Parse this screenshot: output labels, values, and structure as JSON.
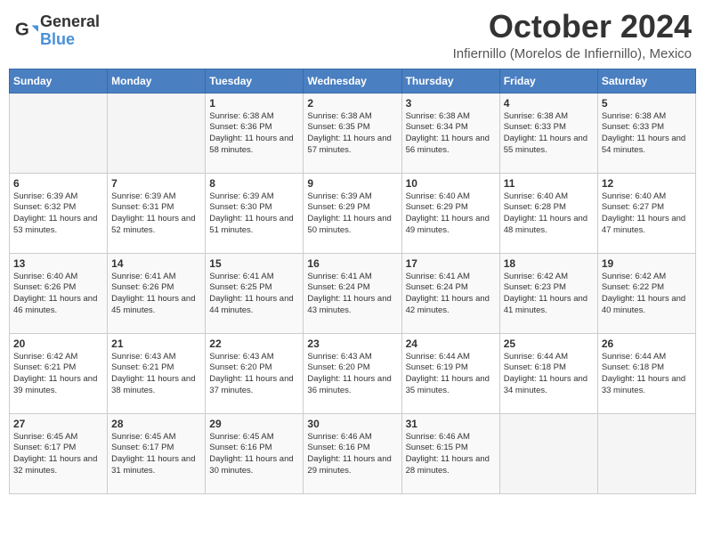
{
  "header": {
    "logo_line1": "General",
    "logo_line2": "Blue",
    "month": "October 2024",
    "subtitle": "Infiernillo (Morelos de Infiernillo), Mexico"
  },
  "weekdays": [
    "Sunday",
    "Monday",
    "Tuesday",
    "Wednesday",
    "Thursday",
    "Friday",
    "Saturday"
  ],
  "weeks": [
    [
      {
        "day": "",
        "info": ""
      },
      {
        "day": "",
        "info": ""
      },
      {
        "day": "1",
        "info": "Sunrise: 6:38 AM\nSunset: 6:36 PM\nDaylight: 11 hours and 58 minutes."
      },
      {
        "day": "2",
        "info": "Sunrise: 6:38 AM\nSunset: 6:35 PM\nDaylight: 11 hours and 57 minutes."
      },
      {
        "day": "3",
        "info": "Sunrise: 6:38 AM\nSunset: 6:34 PM\nDaylight: 11 hours and 56 minutes."
      },
      {
        "day": "4",
        "info": "Sunrise: 6:38 AM\nSunset: 6:33 PM\nDaylight: 11 hours and 55 minutes."
      },
      {
        "day": "5",
        "info": "Sunrise: 6:38 AM\nSunset: 6:33 PM\nDaylight: 11 hours and 54 minutes."
      }
    ],
    [
      {
        "day": "6",
        "info": "Sunrise: 6:39 AM\nSunset: 6:32 PM\nDaylight: 11 hours and 53 minutes."
      },
      {
        "day": "7",
        "info": "Sunrise: 6:39 AM\nSunset: 6:31 PM\nDaylight: 11 hours and 52 minutes."
      },
      {
        "day": "8",
        "info": "Sunrise: 6:39 AM\nSunset: 6:30 PM\nDaylight: 11 hours and 51 minutes."
      },
      {
        "day": "9",
        "info": "Sunrise: 6:39 AM\nSunset: 6:29 PM\nDaylight: 11 hours and 50 minutes."
      },
      {
        "day": "10",
        "info": "Sunrise: 6:40 AM\nSunset: 6:29 PM\nDaylight: 11 hours and 49 minutes."
      },
      {
        "day": "11",
        "info": "Sunrise: 6:40 AM\nSunset: 6:28 PM\nDaylight: 11 hours and 48 minutes."
      },
      {
        "day": "12",
        "info": "Sunrise: 6:40 AM\nSunset: 6:27 PM\nDaylight: 11 hours and 47 minutes."
      }
    ],
    [
      {
        "day": "13",
        "info": "Sunrise: 6:40 AM\nSunset: 6:26 PM\nDaylight: 11 hours and 46 minutes."
      },
      {
        "day": "14",
        "info": "Sunrise: 6:41 AM\nSunset: 6:26 PM\nDaylight: 11 hours and 45 minutes."
      },
      {
        "day": "15",
        "info": "Sunrise: 6:41 AM\nSunset: 6:25 PM\nDaylight: 11 hours and 44 minutes."
      },
      {
        "day": "16",
        "info": "Sunrise: 6:41 AM\nSunset: 6:24 PM\nDaylight: 11 hours and 43 minutes."
      },
      {
        "day": "17",
        "info": "Sunrise: 6:41 AM\nSunset: 6:24 PM\nDaylight: 11 hours and 42 minutes."
      },
      {
        "day": "18",
        "info": "Sunrise: 6:42 AM\nSunset: 6:23 PM\nDaylight: 11 hours and 41 minutes."
      },
      {
        "day": "19",
        "info": "Sunrise: 6:42 AM\nSunset: 6:22 PM\nDaylight: 11 hours and 40 minutes."
      }
    ],
    [
      {
        "day": "20",
        "info": "Sunrise: 6:42 AM\nSunset: 6:21 PM\nDaylight: 11 hours and 39 minutes."
      },
      {
        "day": "21",
        "info": "Sunrise: 6:43 AM\nSunset: 6:21 PM\nDaylight: 11 hours and 38 minutes."
      },
      {
        "day": "22",
        "info": "Sunrise: 6:43 AM\nSunset: 6:20 PM\nDaylight: 11 hours and 37 minutes."
      },
      {
        "day": "23",
        "info": "Sunrise: 6:43 AM\nSunset: 6:20 PM\nDaylight: 11 hours and 36 minutes."
      },
      {
        "day": "24",
        "info": "Sunrise: 6:44 AM\nSunset: 6:19 PM\nDaylight: 11 hours and 35 minutes."
      },
      {
        "day": "25",
        "info": "Sunrise: 6:44 AM\nSunset: 6:18 PM\nDaylight: 11 hours and 34 minutes."
      },
      {
        "day": "26",
        "info": "Sunrise: 6:44 AM\nSunset: 6:18 PM\nDaylight: 11 hours and 33 minutes."
      }
    ],
    [
      {
        "day": "27",
        "info": "Sunrise: 6:45 AM\nSunset: 6:17 PM\nDaylight: 11 hours and 32 minutes."
      },
      {
        "day": "28",
        "info": "Sunrise: 6:45 AM\nSunset: 6:17 PM\nDaylight: 11 hours and 31 minutes."
      },
      {
        "day": "29",
        "info": "Sunrise: 6:45 AM\nSunset: 6:16 PM\nDaylight: 11 hours and 30 minutes."
      },
      {
        "day": "30",
        "info": "Sunrise: 6:46 AM\nSunset: 6:16 PM\nDaylight: 11 hours and 29 minutes."
      },
      {
        "day": "31",
        "info": "Sunrise: 6:46 AM\nSunset: 6:15 PM\nDaylight: 11 hours and 28 minutes."
      },
      {
        "day": "",
        "info": ""
      },
      {
        "day": "",
        "info": ""
      }
    ]
  ]
}
